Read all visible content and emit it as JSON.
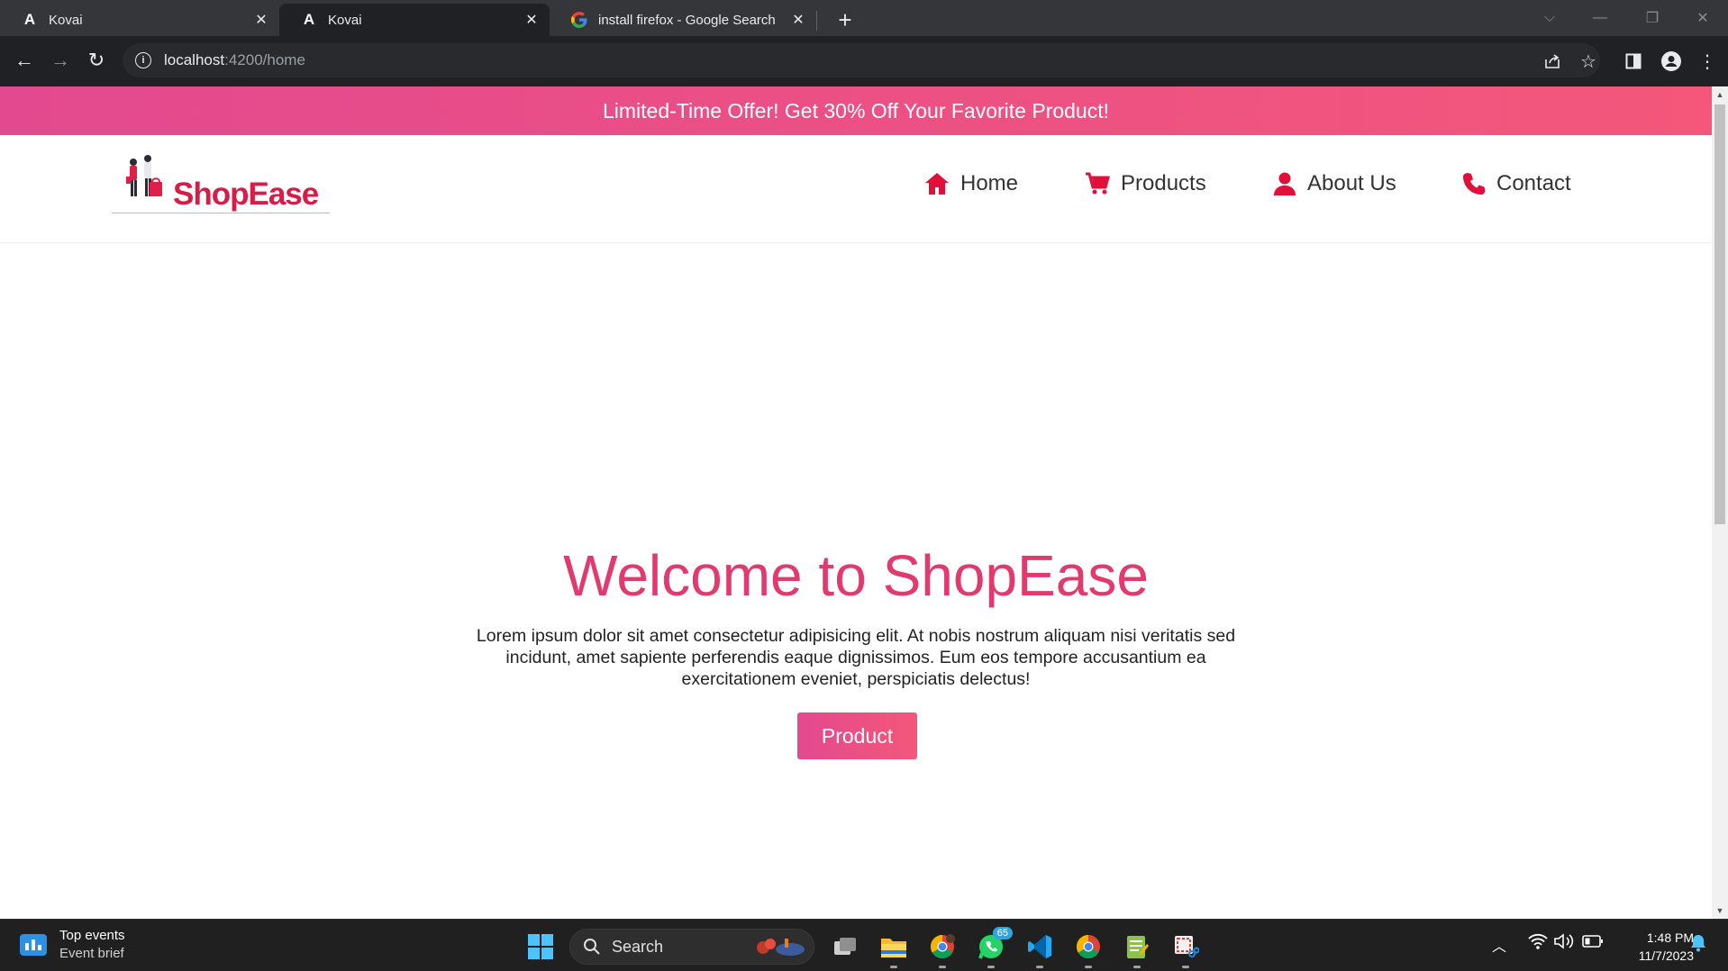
{
  "browser": {
    "tabs": [
      {
        "title": "Kovai",
        "active": false,
        "favicon": "angular-icon"
      },
      {
        "title": "Kovai",
        "active": true,
        "favicon": "angular-icon"
      },
      {
        "title": "install firefox - Google Search",
        "active": false,
        "favicon": "google-icon"
      }
    ],
    "url_host": "localhost",
    "url_path": ":4200/home"
  },
  "page": {
    "promo": "Limited-Time Offer! Get 30% Off Your Favorite Product!",
    "brand": "ShopEase",
    "nav": [
      {
        "label": "Home",
        "icon": "home-icon"
      },
      {
        "label": "Products",
        "icon": "cart-icon"
      },
      {
        "label": "About Us",
        "icon": "user-icon"
      },
      {
        "label": "Contact",
        "icon": "phone-icon"
      }
    ],
    "hero": {
      "title": "Welcome to ShopEase",
      "body": "Lorem ipsum dolor sit amet consectetur adipisicing elit. At nobis nostrum aliquam nisi veritatis sed incidunt, amet sapiente perferendis eaque dignissimos. Eum eos tempore accusantium ea exercitationem eveniet, perspiciatis delectus!",
      "button": "Product"
    },
    "colors": {
      "accent": "#e23a6e",
      "brand": "#d81b47",
      "promo_start": "#e3498f",
      "promo_end": "#f4577a"
    }
  },
  "taskbar": {
    "widget_title": "Top events",
    "widget_sub": "Event brief",
    "search_label": "Search",
    "whatsapp_badge": "65",
    "time": "1:48 PM",
    "date": "11/7/2023"
  }
}
